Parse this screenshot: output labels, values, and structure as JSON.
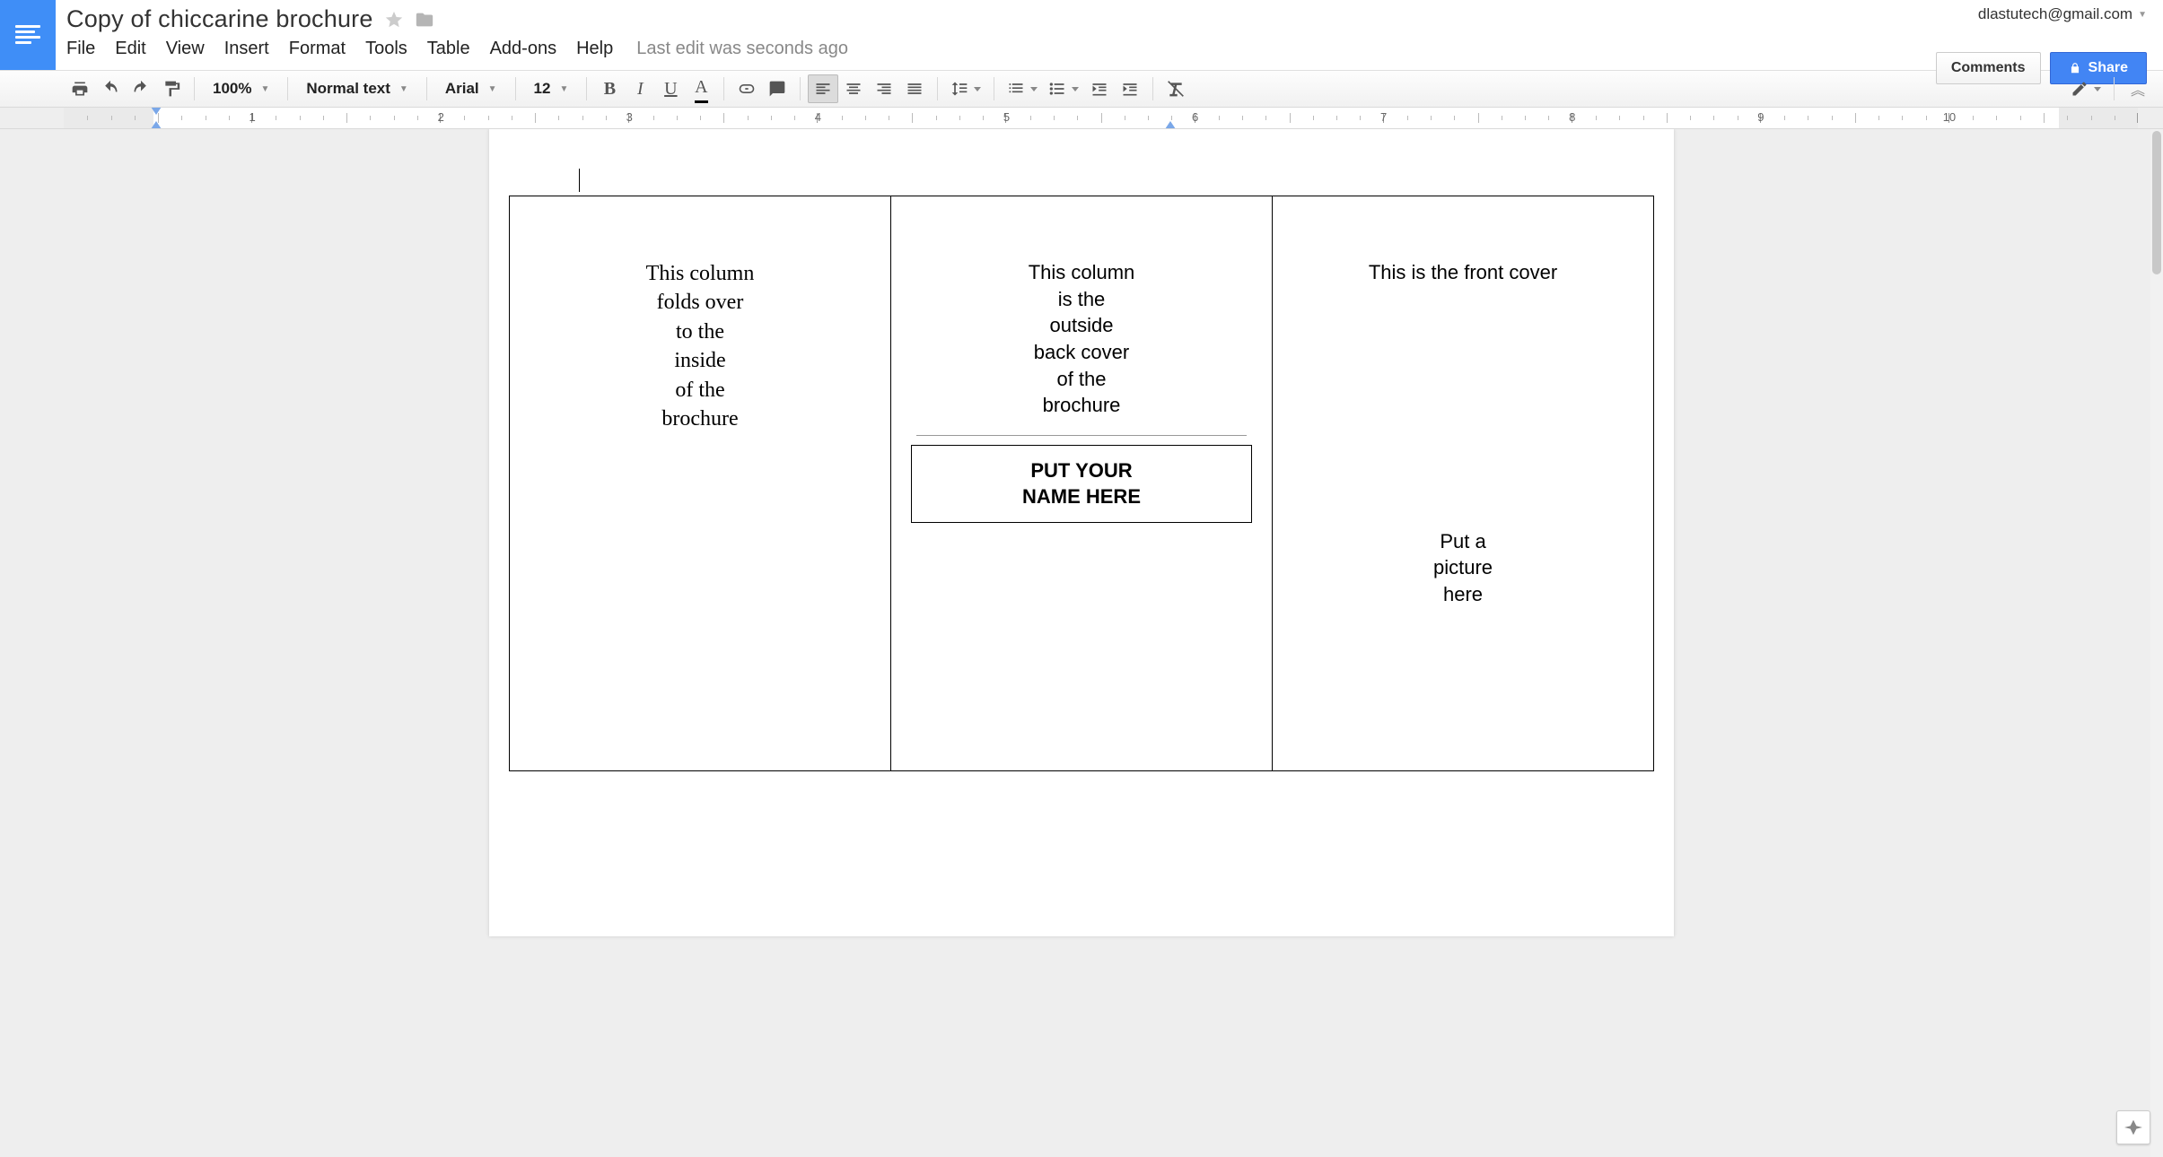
{
  "header": {
    "doc_title": "Copy of chiccarine brochure",
    "user_email": "dlastutech@gmail.com",
    "comments_label": "Comments",
    "share_label": "Share"
  },
  "menus": {
    "file": "File",
    "edit": "Edit",
    "view": "View",
    "insert": "Insert",
    "format": "Format",
    "tools": "Tools",
    "table": "Table",
    "addons": "Add-ons",
    "help": "Help",
    "last_edit": "Last edit was seconds ago"
  },
  "toolbar": {
    "zoom": "100%",
    "style": "Normal text",
    "font": "Arial",
    "size": "12"
  },
  "ruler": {
    "labels": [
      "1",
      "2",
      "3",
      "4",
      "5",
      "6",
      "7",
      "8",
      "9",
      "10"
    ]
  },
  "document": {
    "col1_lines": [
      "This column",
      "folds over",
      "to the",
      "inside",
      "of the",
      "brochure"
    ],
    "col2_lines": [
      "This column",
      "is the",
      "outside",
      "back cover",
      "of the",
      "brochure"
    ],
    "name_box_lines": [
      "PUT YOUR",
      "NAME HERE"
    ],
    "col3_title": "This is the front cover",
    "col3_pic_lines": [
      "Put a",
      "picture",
      "here"
    ]
  }
}
